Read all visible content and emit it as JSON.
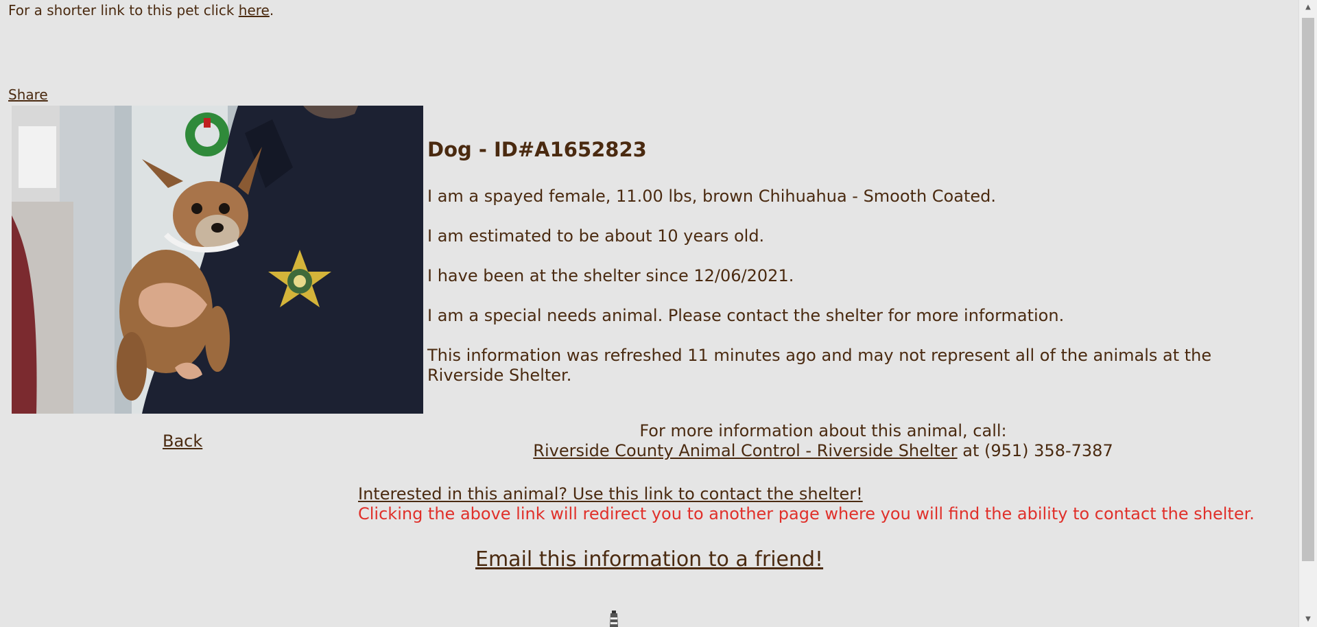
{
  "shortlink": {
    "prefix": "For a shorter link to this pet click ",
    "link": "here",
    "suffix": "."
  },
  "share": "Share",
  "back": "Back",
  "animal": {
    "title": "Dog - ID#A1652823",
    "line1": "I am a spayed female, 11.00 lbs, brown Chihuahua - Smooth Coated.",
    "line2": "I am estimated to be about 10 years old.",
    "line3": "I have been at the shelter since 12/06/2021.",
    "line4": "I am a special needs animal. Please contact the shelter for more information.",
    "line5": "This information was refreshed 11 minutes ago and may not represent all of the animals at the Riverside Shelter."
  },
  "contact": {
    "call_text": "For more information about this animal, call:",
    "shelter_link": "Riverside County Animal Control - Riverside Shelter",
    "phone_prefix": " at ",
    "phone": "(951) 358-7387",
    "interested_link": "Interested in this animal? Use this link to contact the shelter!",
    "redirect_note": "Clicking the above link will redirect you to another page where you will find the ability to contact the shelter.",
    "email_link": "Email this information to a friend!"
  },
  "colors": {
    "background": "#e5e5e5",
    "text": "#4a2a10",
    "warning": "#e0302a"
  }
}
